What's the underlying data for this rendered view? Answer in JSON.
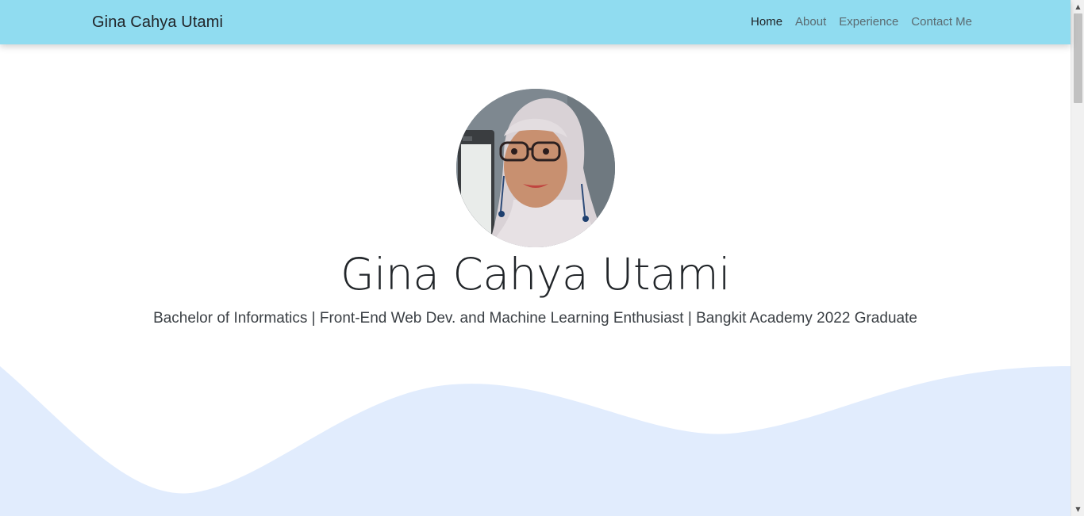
{
  "navbar": {
    "brand": "Gina Cahya Utami",
    "links": [
      {
        "label": "Home",
        "active": true
      },
      {
        "label": "About",
        "active": false
      },
      {
        "label": "Experience",
        "active": false
      },
      {
        "label": "Contact Me",
        "active": false
      }
    ],
    "bg_color": "#90dcf0"
  },
  "hero": {
    "name": "Gina Cahya Utami",
    "subtitle": "Bachelor of Informatics | Front-End Web Dev. and Machine Learning Enthusiast | Bangkit Academy 2022 Graduate",
    "avatar_icon": "profile-photo",
    "wave_color": "#e1ecfd"
  },
  "scrollbar": {
    "up_icon": "▲",
    "down_icon": "▼"
  }
}
